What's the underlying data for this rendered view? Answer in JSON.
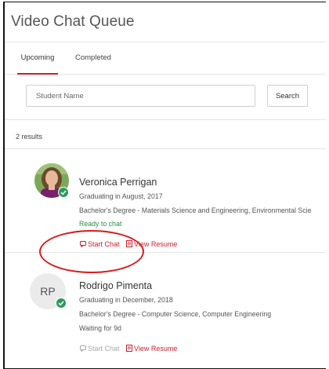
{
  "page": {
    "title": "Video Chat Queue",
    "tabs": [
      {
        "label": "Upcoming",
        "active": true
      },
      {
        "label": "Completed",
        "active": false
      }
    ]
  },
  "search": {
    "placeholder": "Student Name",
    "button_label": "Search"
  },
  "results_count": "2 results",
  "students": [
    {
      "name": "Veronica Perrigan",
      "graduation": "Graduating in August, 2017",
      "degree": "Bachelor's Degree - Materials Science and Engineering, Environmental Scie",
      "status": "Ready to chat",
      "status_color": "#2e8b46",
      "avatar": "photo",
      "online": true,
      "start_chat_label": "Start Chat",
      "view_resume_label": "View Resume",
      "start_chat_enabled": true
    },
    {
      "name": "Rodrigo Pimenta",
      "initials": "RP",
      "graduation": "Graduating in December, 2018",
      "degree": "Bachelor's Degree - Computer Science, Computer Engineering",
      "status": "Waiting for 9d",
      "avatar": "initials",
      "online": true,
      "start_chat_label": "Start Chat",
      "view_resume_label": "View Resume",
      "start_chat_enabled": false
    }
  ],
  "colors": {
    "accent": "#c8202f",
    "online_badge": "#2a9b59",
    "annotation": "#d91a1a"
  },
  "icons": {
    "start_chat": "chat-bubble-icon",
    "view_resume": "document-icon",
    "online": "check-icon"
  }
}
